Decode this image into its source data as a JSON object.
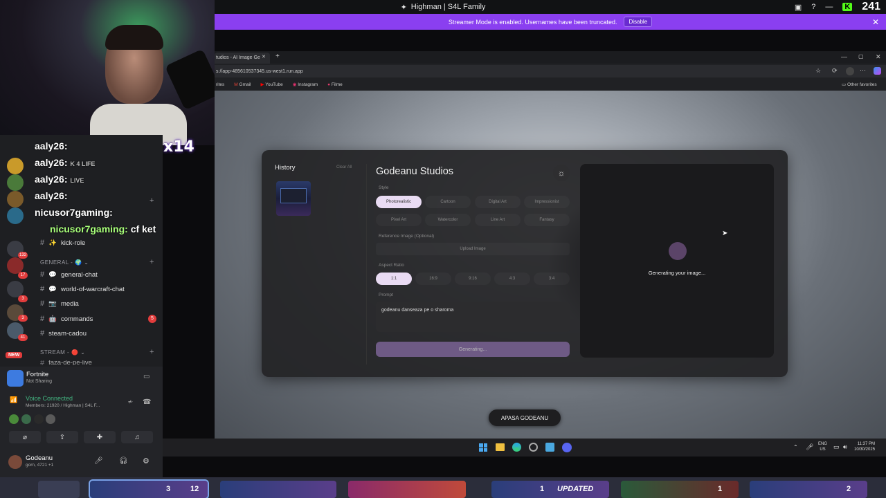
{
  "window_title": "Highman | S4L Family",
  "kick": {
    "badge": "K",
    "viewers": "241"
  },
  "streamer_banner": {
    "text": "Streamer Mode is enabled. Usernames have been truncated.",
    "button": "Disable",
    "close": "✕"
  },
  "webcam": {
    "multiplier": "x14"
  },
  "chat": [
    {
      "user": "aaly26:",
      "text": "K 4 LIFE"
    },
    {
      "user": "aaly26:",
      "text": "LIVE"
    },
    {
      "user": "aaly26:",
      "text": ""
    },
    {
      "user": "aaly26:",
      "text": ""
    },
    {
      "user": "nicusor7gaming:",
      "text": "cf ket"
    }
  ],
  "discord": {
    "channels_top": [
      {
        "name": "kick-role",
        "emoji": "✨"
      }
    ],
    "category_general": "GENERAL - 🌍 ⌄",
    "channels_general": [
      {
        "name": "general-chat",
        "emoji": "💬"
      },
      {
        "name": "world-of-warcraft-chat",
        "emoji": "💬"
      },
      {
        "name": "media",
        "emoji": "📷"
      },
      {
        "name": "commands",
        "emoji": "🤖",
        "badge": "5"
      },
      {
        "name": "steam-cadou",
        "emoji": ""
      }
    ],
    "category_stream": "STREAM - 🔴 ⌄",
    "partial_channel": "faza-de-pe-live",
    "guild_badges": [
      "132",
      "17",
      "3",
      "3",
      "41"
    ],
    "new_label": "NEW",
    "activity": {
      "title": "Fortnite",
      "sub": "Not Sharing"
    },
    "voice": {
      "status": "Voice Connected",
      "detail": "Members: 21920 / Highman | S4L F..."
    },
    "user": {
      "name": "Godeanu",
      "sub": "gorn, 4721 +1"
    }
  },
  "browser": {
    "tab_title": "tudios - AI Image Ge",
    "url": "s://app-485610537345.us-west1.run.app",
    "bookmarks": [
      "rites",
      "Gmail",
      "YouTube",
      "Instagram",
      "Filme"
    ],
    "other_favorites": "Other favorites"
  },
  "app": {
    "history_title": "History",
    "clear_all": "Clear All",
    "title": "Godeanu Studios",
    "style_label": "Style",
    "styles": [
      "Photorealistic",
      "Cartoon",
      "Digital Art",
      "Impressionist",
      "Pixel Art",
      "Watercolor",
      "Line Art",
      "Fantasy"
    ],
    "selected_style": "Photorealistic",
    "reference_label": "Reference Image (Optional)",
    "upload_label": "Upload Image",
    "aspect_label": "Aspect Ratio",
    "ratios": [
      "1:1",
      "16:9",
      "9:16",
      "4:3",
      "3:4"
    ],
    "selected_ratio": "1:1",
    "prompt_label": "Prompt",
    "prompt_value": "godeanu danseaza pe o sharoma",
    "generate_button": "Generating...",
    "status": "Generating your image...",
    "apasa": "APASA GODEANU"
  },
  "taskbar": {
    "lang": "ENG",
    "region": "US",
    "time": "11:37 PM",
    "date": "10/30/2025"
  },
  "bottom_strip": {
    "labels": [
      "3",
      "12",
      "1",
      "UPDATED",
      "1",
      "2"
    ]
  }
}
